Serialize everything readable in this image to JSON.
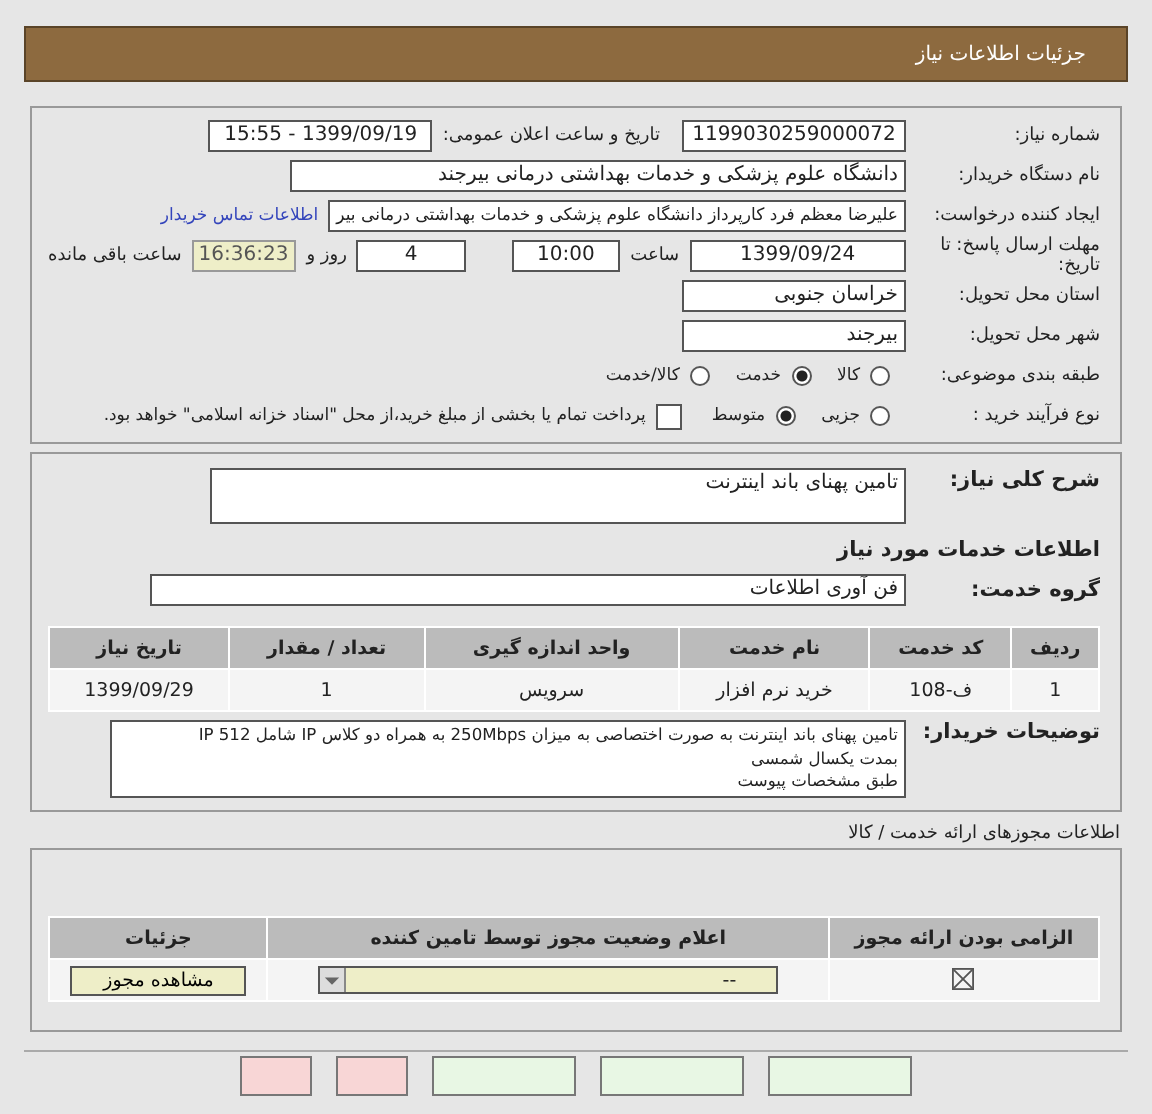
{
  "header": {
    "title": "جزئیات اطلاعات نیاز"
  },
  "need_info": {
    "need_number_label": "شماره نیاز:",
    "need_number": "1199030259000072",
    "announce_label": "تاریخ و ساعت اعلان عمومی:",
    "announce": "1399/09/19 - 15:55",
    "buyer_label": "نام دستگاه خریدار:",
    "buyer": "دانشگاه علوم پزشکی و خدمات بهداشتی درمانی بیرجند",
    "creator_label": "ایجاد کننده درخواست:",
    "creator": "علیرضا معظم فرد کارپرداز دانشگاه علوم پزشکی و خدمات بهداشتی درمانی بیر",
    "contact_link": "اطلاعات تماس خریدار",
    "deadline_label": "مهلت ارسال پاسخ: تا تاریخ:",
    "deadline_date": "1399/09/24",
    "time_label": "ساعت",
    "deadline_time": "10:00",
    "days": "4",
    "days_label": "روز و",
    "remaining": "16:36:23",
    "remaining_label": "ساعت باقی مانده",
    "province_label": "استان محل تحویل:",
    "province": "خراسان جنوبی",
    "city_label": "شهر محل تحویل:",
    "city": "بیرجند",
    "category_label": "طبقه بندی موضوعی:",
    "category_options": [
      {
        "label": "کالا",
        "selected": false
      },
      {
        "label": "خدمت",
        "selected": true
      },
      {
        "label": "کالا/خدمت",
        "selected": false
      }
    ],
    "process_label": "نوع فرآیند خرید :",
    "process_options": [
      {
        "label": "جزیی",
        "selected": false
      },
      {
        "label": "متوسط",
        "selected": true
      }
    ],
    "treasury": {
      "label": "پرداخت تمام یا بخشی از مبلغ خرید،از محل \"اسناد خزانه اسلامی\" خواهد بود.",
      "checked": false
    }
  },
  "services": {
    "summary_label": "شرح کلی نیاز:",
    "summary": "تامین پهنای باند اینترنت",
    "section_title": "اطلاعات خدمات مورد نیاز",
    "group_label": "گروه خدمت:",
    "group": "فن آوری اطلاعات",
    "table": {
      "columns": [
        "ردیف",
        "کد خدمت",
        "نام خدمت",
        "واحد اندازه گیری",
        "تعداد / مقدار",
        "تاریخ نیاز"
      ],
      "rows": [
        [
          "1",
          "ف-108",
          "خرید نرم افزار",
          "سرویس",
          "1",
          "1399/09/29"
        ]
      ]
    },
    "notes_label": "توضیحات خریدار:",
    "notes": [
      "تامین پهنای باند اینترنت به صورت اختصاصی به میزان 250Mbps به همراه دو کلاس IP شامل 512 IP",
      "بمدت یکسال شمسی",
      "طبق مشخصات پیوست"
    ]
  },
  "permits": {
    "title": "اطلاعات مجوزهای ارائه خدمت / کالا",
    "columns": [
      "الزامی بودن ارائه مجوز",
      "اعلام وضعیت مجوز توسط تامین کننده",
      "جزئیات"
    ],
    "rows": [
      {
        "required": true,
        "status": "--",
        "action": "مشاهده مجوز"
      }
    ]
  },
  "bottom_buttons": [
    {
      "kind": "plain"
    },
    {
      "kind": "plain"
    },
    {
      "kind": "plain"
    },
    {
      "kind": "warn"
    },
    {
      "kind": "warn"
    }
  ]
}
